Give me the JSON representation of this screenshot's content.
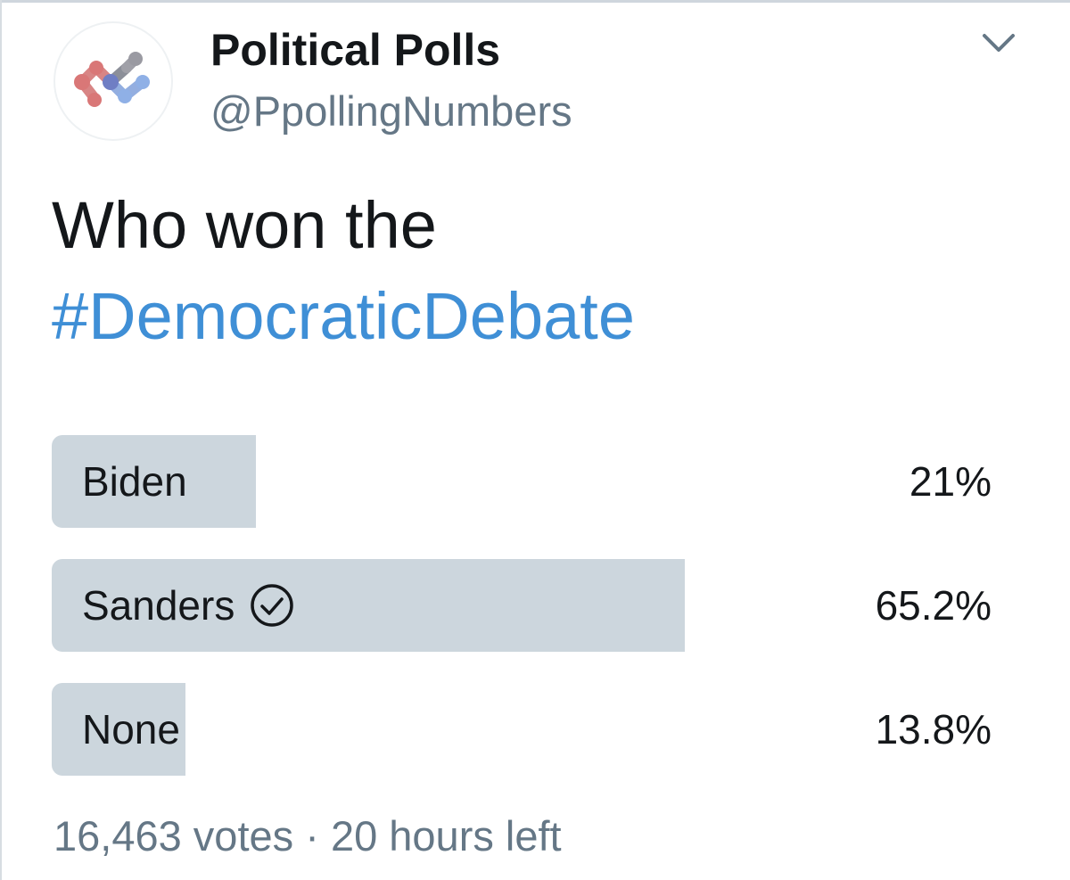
{
  "tweet": {
    "author": {
      "display_name": "Political Polls",
      "handle": "@PpollingNumbers",
      "avatar_icon": "network-nodes-logo"
    },
    "menu_icon": "chevron-down-icon",
    "text_plain": "Who won the",
    "hashtag": "#DemocraticDebate",
    "colors": {
      "hashtag": "#3f8fd6",
      "poll_bar": "#ccd6dd",
      "secondary_text": "#657786"
    },
    "poll": {
      "options": [
        {
          "label": "Biden",
          "percent_text": "21%",
          "fraction": 0.21,
          "chosen": false
        },
        {
          "label": "Sanders",
          "percent_text": "65.2%",
          "fraction": 0.652,
          "chosen": true
        },
        {
          "label": "None",
          "percent_text": "13.8%",
          "fraction": 0.138,
          "chosen": false
        }
      ],
      "votes": "16,463 votes",
      "separator": "·",
      "time_left": "20 hours left"
    }
  }
}
